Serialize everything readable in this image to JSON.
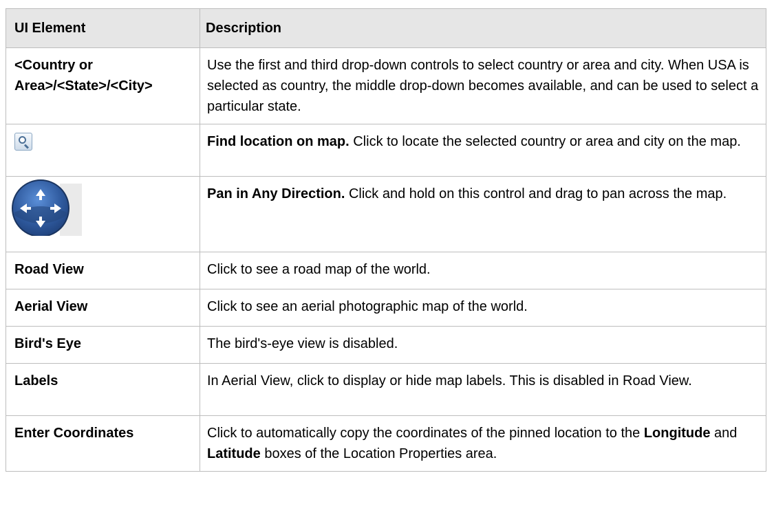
{
  "table": {
    "headers": {
      "ui_element": "UI Element",
      "description": "Description"
    },
    "rows": [
      {
        "element": "<Country or Area>/<State>/<City>",
        "description": "Use the first and third drop-down controls to select country or area and city. When USA is selected as country, the middle drop-down becomes available, and can be used to select a particular state."
      },
      {
        "element_icon": "magnifier-find-icon",
        "description_bold": "Find location on map.",
        "description": "Click to locate the selected country or area and city on the map."
      },
      {
        "element_icon": "pan-compass-icon",
        "description_bold": "Pan in Any Direction.",
        "description": "Click and hold on this control and drag to pan across the map."
      },
      {
        "element": "Road View",
        "description": "Click to see a road map of the world."
      },
      {
        "element": "Aerial View",
        "description": "Click to see an aerial photographic map of the world."
      },
      {
        "element": "Bird's Eye",
        "description": "The bird's-eye view is disabled."
      },
      {
        "element": "Labels",
        "description": "In Aerial View, click to display or hide map labels. This is disabled in Road View."
      },
      {
        "element": "Enter Coordinates",
        "description_part1": "Click to automatically copy the coordinates of the pinned location to the",
        "description_bold1": "Longitude",
        "description_part2": "and",
        "description_bold2": "Latitude",
        "description_part3": "boxes of the Location Properties area."
      }
    ]
  },
  "colors": {
    "header_bg": "#e6e6e6",
    "border": "#bdbdbd",
    "icon_blue": "#2f5a9e"
  }
}
